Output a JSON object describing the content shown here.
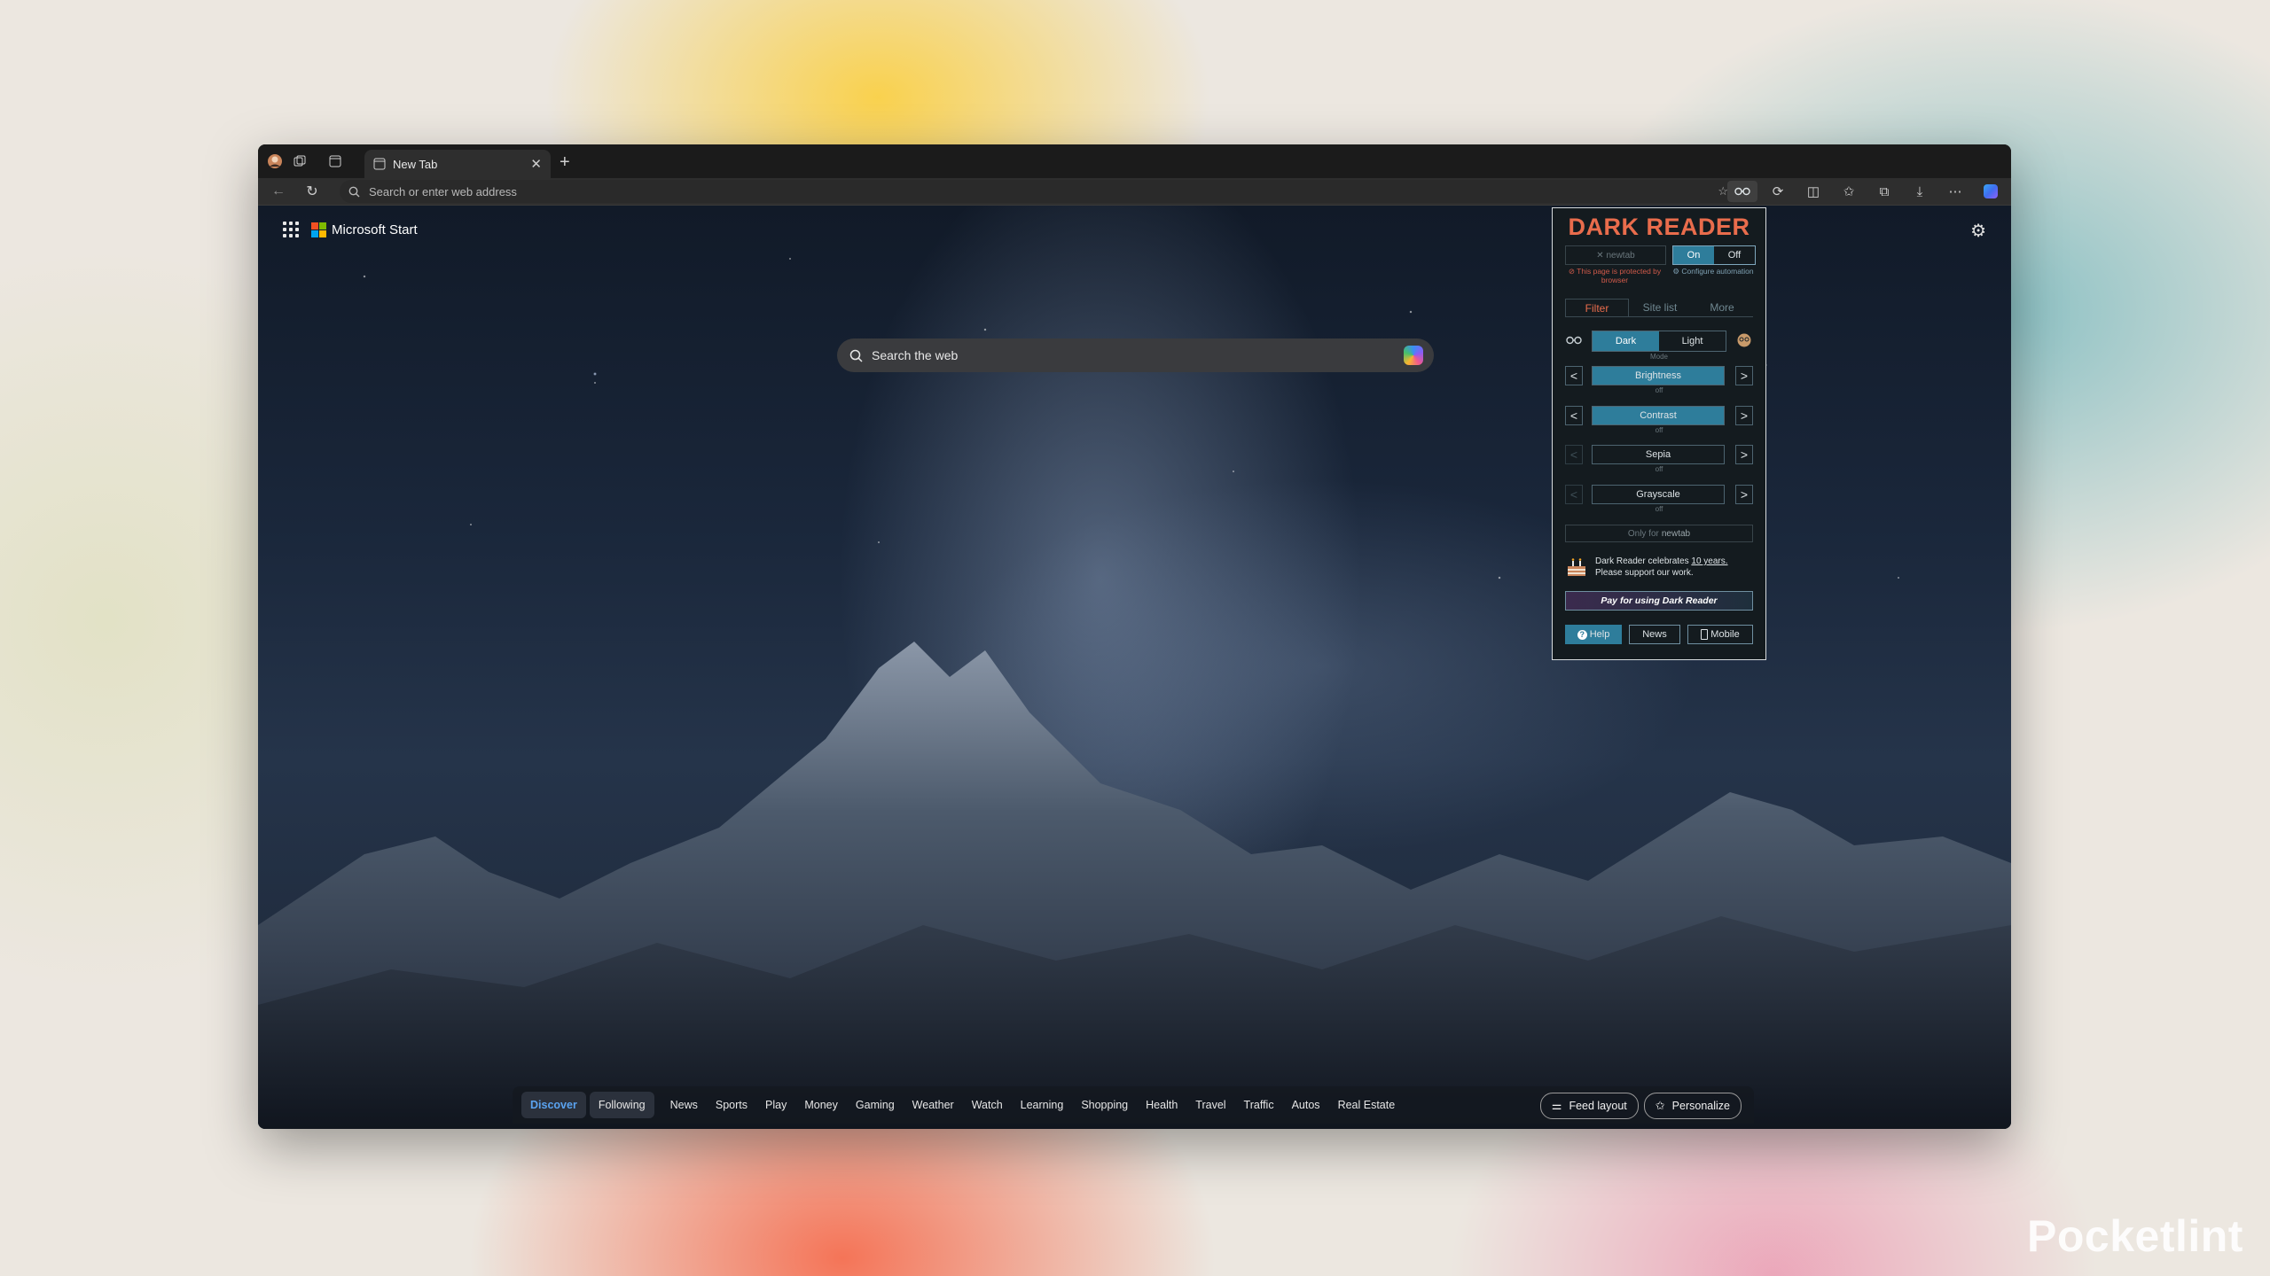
{
  "browser": {
    "tab": {
      "title": "New Tab"
    },
    "address_placeholder": "Search or enter web address"
  },
  "newtab": {
    "brand": "Microsoft Start",
    "search_placeholder": "Search the web"
  },
  "dark_reader": {
    "title": "DARK READER",
    "site": "newtab",
    "on_label": "On",
    "off_label": "Off",
    "state": "On",
    "protected_note": "This page is protected by browser",
    "configure_note": "Configure automation",
    "tabs": [
      "Filter",
      "Site list",
      "More"
    ],
    "active_tab": "Filter",
    "mode": {
      "dark": "Dark",
      "light": "Light",
      "label": "Mode",
      "selected": "Dark"
    },
    "sliders": [
      {
        "name": "Brightness",
        "status": "off"
      },
      {
        "name": "Contrast",
        "status": "off"
      },
      {
        "name": "Sepia",
        "status": "off"
      },
      {
        "name": "Grayscale",
        "status": "off"
      }
    ],
    "only_for_prefix": "Only for",
    "only_for_site": "newtab",
    "promo_text": "Dark Reader celebrates",
    "promo_link": "10 years.",
    "promo_text2": "Please support our work.",
    "pay_button": "Pay for using Dark Reader",
    "help": "Help",
    "news": "News",
    "mobile": "Mobile"
  },
  "feed": {
    "categories": [
      "Discover",
      "Following",
      "News",
      "Sports",
      "Play",
      "Money",
      "Gaming",
      "Weather",
      "Watch",
      "Learning",
      "Shopping",
      "Health",
      "Travel",
      "Traffic",
      "Autos",
      "Real Estate"
    ],
    "feed_layout": "Feed layout",
    "personalize": "Personalize"
  },
  "watermark": "Pocketlint"
}
